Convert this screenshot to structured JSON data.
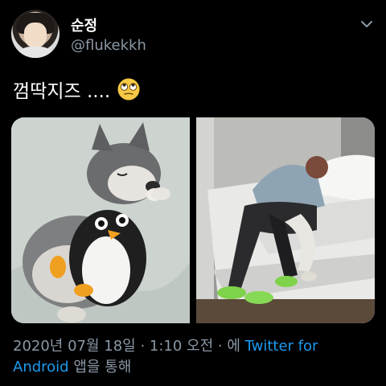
{
  "user": {
    "display_name": "순정",
    "handle": "@flukekkh"
  },
  "tweet": {
    "text": "껌딱지즈 ...."
  },
  "icons": {
    "menu": "chevron-down-icon",
    "emoji": "face-with-rolling-eyes-emoji"
  },
  "media": {
    "left_subject": "husky-puppy-with-penguin-plush",
    "right_subject": "two-people-hugging-on-bed"
  },
  "meta": {
    "datetime": "2020년 07월 18일 · 1:10 오전 · 에 ",
    "client_line1": "Twitter for",
    "client_line2": "Android",
    "suffix": " 앱을 통해"
  },
  "colors": {
    "background": "#000000",
    "text": "#ffffff",
    "secondary": "#8b98a5",
    "link": "#1d9bf0"
  }
}
